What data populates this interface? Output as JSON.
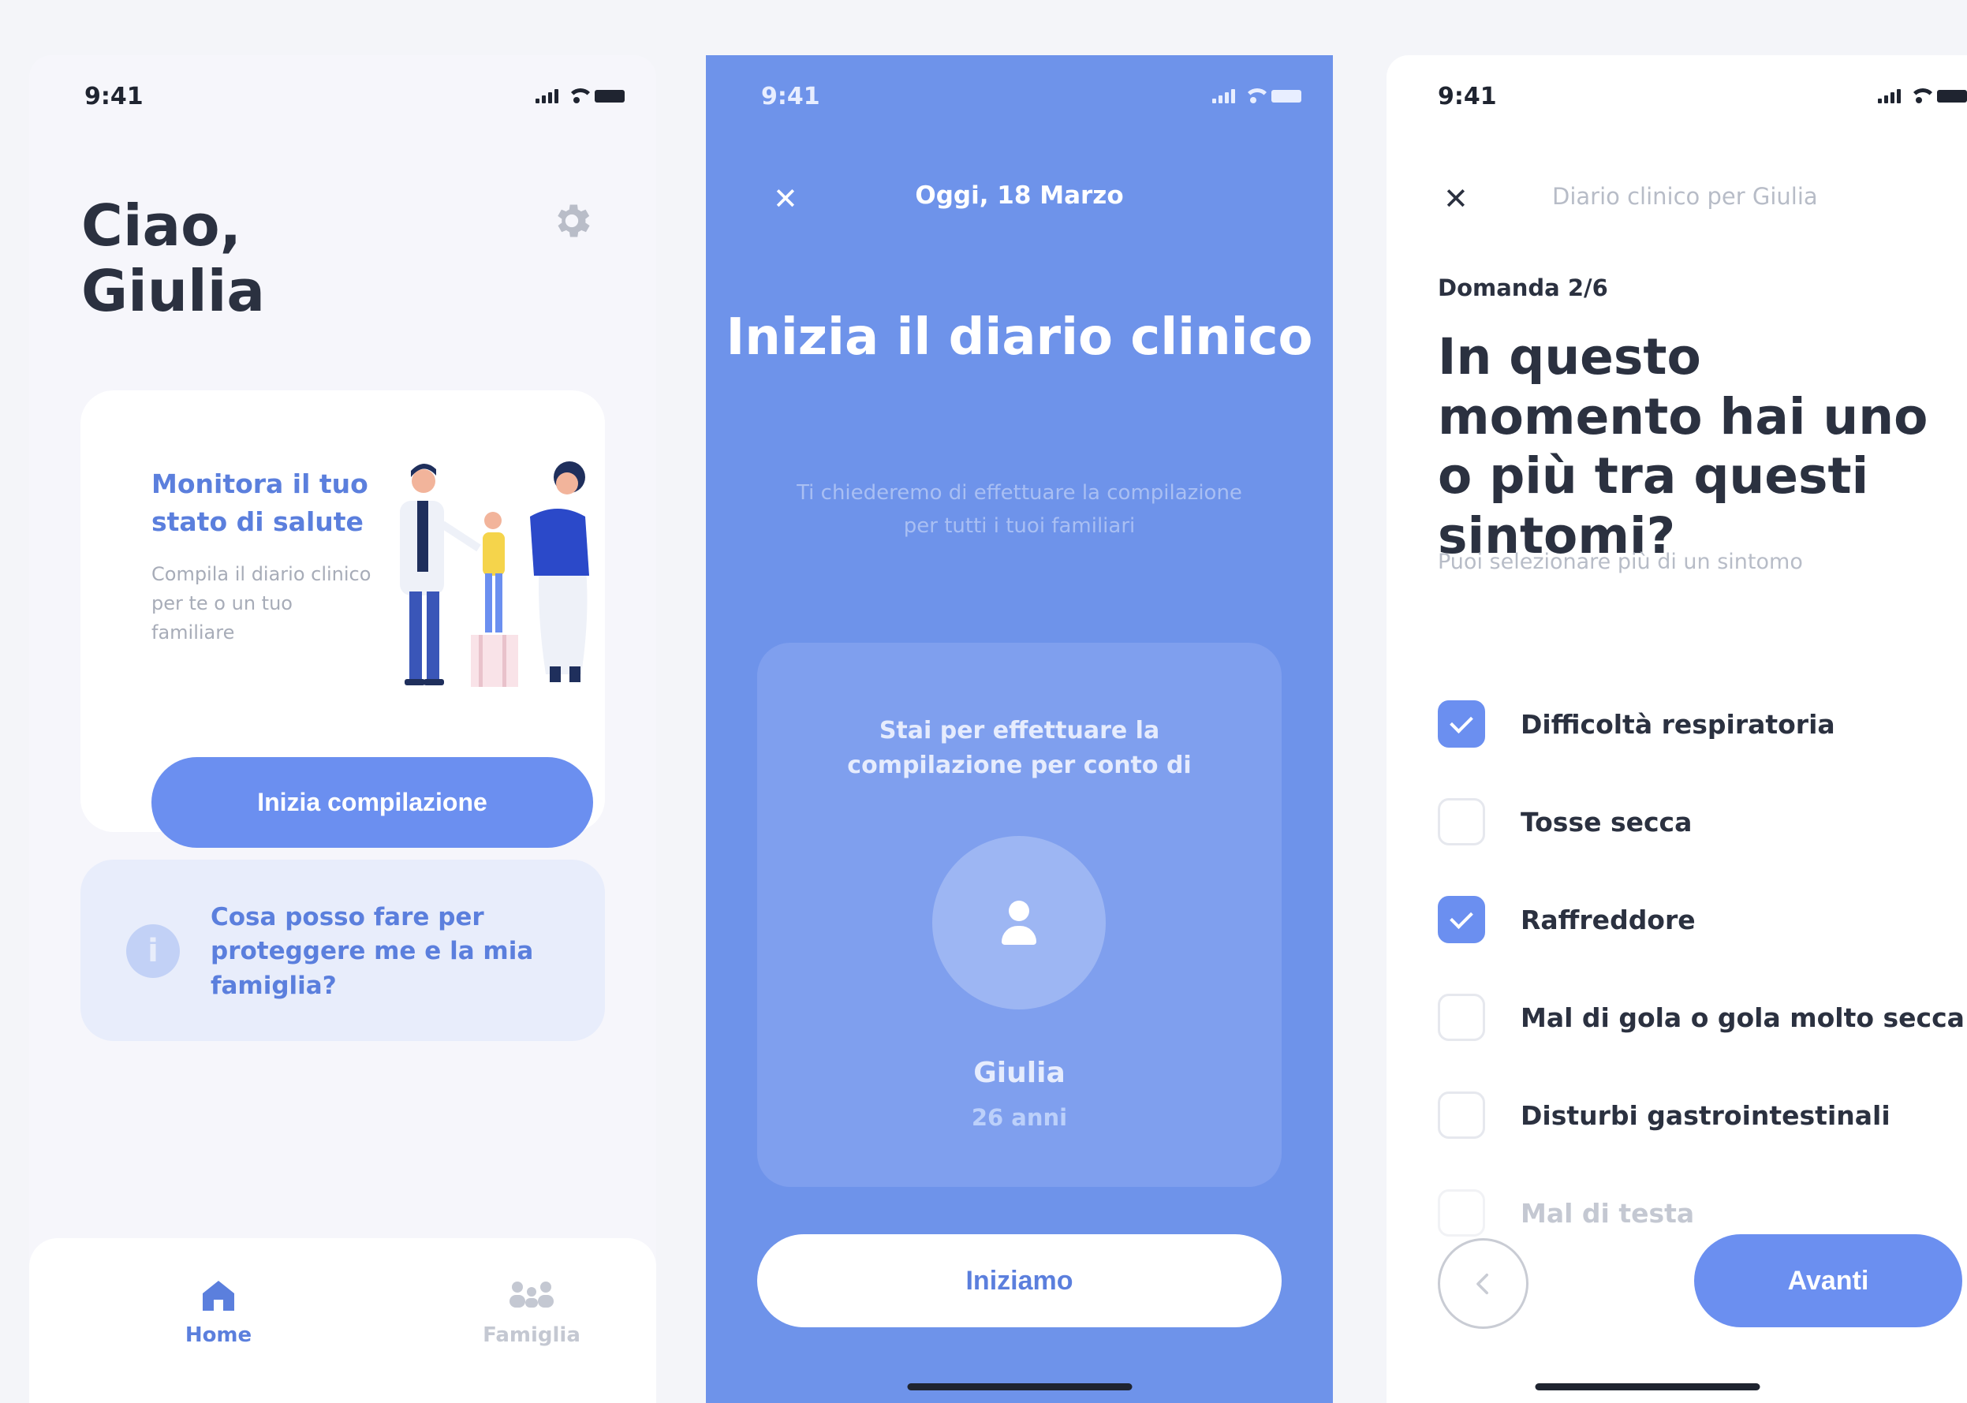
{
  "screen1": {
    "status_time": "9:41",
    "greeting": "Ciao, Giulia",
    "card": {
      "title": "Monitora il tuo stato di salute",
      "description": "Compila il diario clinico per te o un tuo familiare",
      "button_label": "Inizia compilazione"
    },
    "info_card": {
      "icon_glyph": "i",
      "text": "Cosa posso fare per proteggere me e la mia famiglia?"
    },
    "tabs": [
      {
        "label": "Home",
        "icon": "home-icon",
        "active": true
      },
      {
        "label": "Famiglia",
        "icon": "family-icon",
        "active": false
      }
    ]
  },
  "screen2": {
    "status_time": "9:41",
    "close_glyph": "✕",
    "date": "Oggi, 18 Marzo",
    "title": "Inizia il diario clinico",
    "subtitle": "Ti chiederemo di effettuare la compilazione per tutti i tuoi familiari",
    "box_text": "Stai per effettuare la compilazione per conto di",
    "person_name": "Giulia",
    "person_age": "26 anni",
    "button_label": "Iniziamo"
  },
  "screen3": {
    "status_time": "9:41",
    "close_glyph": "✕",
    "header": "Diario clinico per Giulia",
    "step": "Domanda 2/6",
    "question": "In questo momento hai uno o più tra questi sintomi?",
    "hint": "Puoi selezionare più di un sintomo",
    "options": [
      {
        "label": "Difficoltà respiratoria",
        "checked": true
      },
      {
        "label": "Tosse secca",
        "checked": false
      },
      {
        "label": "Raffreddore",
        "checked": true
      },
      {
        "label": "Mal di gola o gola molto secca",
        "checked": false
      },
      {
        "label": "Disturbi gastrointestinali",
        "checked": false
      },
      {
        "label": "Mal di testa",
        "checked": false
      }
    ],
    "next_label": "Avanti"
  },
  "colors": {
    "accent": "#6b8ff0",
    "accent_text": "#5b7fdd",
    "dark_text": "#2b3140",
    "muted_text": "#b7bcc7",
    "panel_blue": "#6e93ea"
  }
}
